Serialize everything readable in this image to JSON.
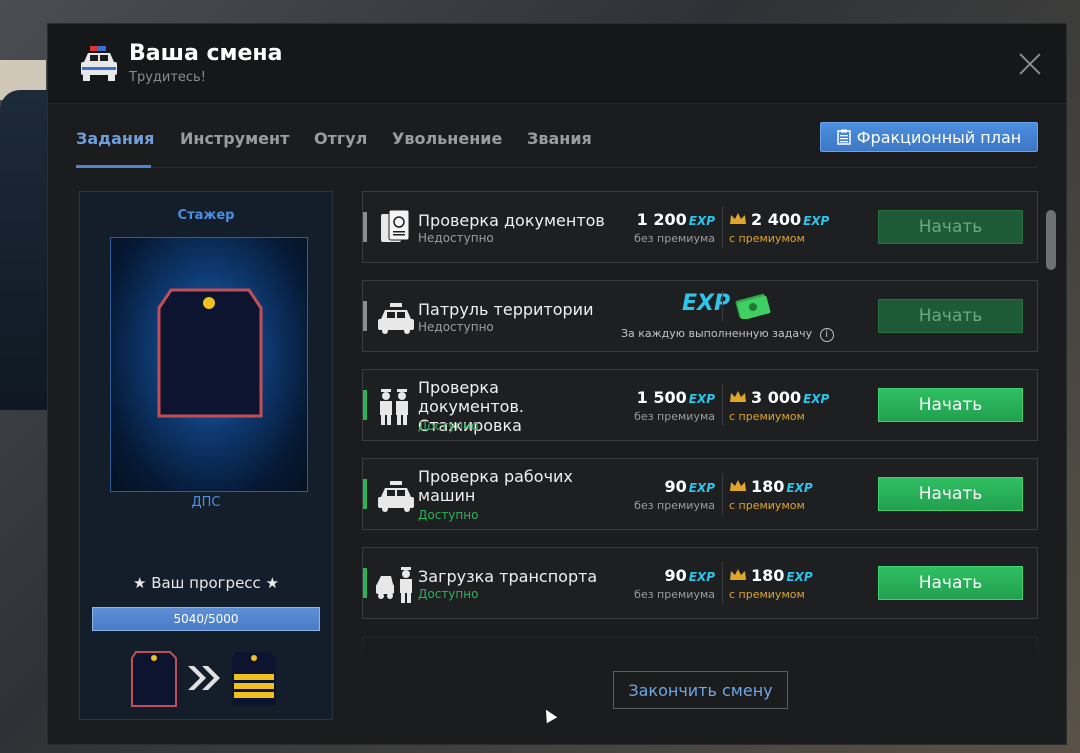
{
  "header": {
    "title": "Ваша смена",
    "subtitle": "Трудитесь!"
  },
  "tabs": [
    {
      "label": "Задания",
      "active": true
    },
    {
      "label": "Инструмент",
      "active": false
    },
    {
      "label": "Отгул",
      "active": false
    },
    {
      "label": "Увольнение",
      "active": false
    },
    {
      "label": "Звания",
      "active": false
    }
  ],
  "plan_button": {
    "label": "Фракционный план",
    "icon": "clipboard-icon"
  },
  "rank": {
    "name": "Стажер",
    "unit": "ДПС",
    "progress_label": "Ваш прогресс",
    "progress_text": "5040/5000",
    "progress_fraction": 1.0
  },
  "tasks": [
    {
      "name": "Проверка документов",
      "status": "Недоступно",
      "available": false,
      "reward": "1 200",
      "reward_premium": "2 400",
      "button": "Начать",
      "icon": "passport-icon"
    },
    {
      "name": "Патруль территории",
      "status": "Недоступно",
      "available": false,
      "special": true,
      "per_task_text": "За каждую выполненную задачу",
      "button": "Начать",
      "icon": "police-car-icon"
    },
    {
      "name": "Проверка документов. Стажировка",
      "status": "Доступно",
      "available": true,
      "reward": "1 500",
      "reward_premium": "3 000",
      "button": "Начать",
      "icon": "officers-icon"
    },
    {
      "name": "Проверка рабочих машин",
      "status": "Доступно",
      "available": true,
      "reward": "90",
      "reward_premium": "180",
      "button": "Начать",
      "icon": "police-car-icon"
    },
    {
      "name": "Загрузка транспорта",
      "status": "Доступно",
      "available": true,
      "reward": "90",
      "reward_premium": "180",
      "button": "Начать",
      "icon": "tow-truck-icon"
    }
  ],
  "labels": {
    "exp": "EXP",
    "no_premium": "без премиума",
    "with_premium": "с премиумом"
  },
  "end_button": "Закончить смену",
  "colors": {
    "accent": "#4b86d4",
    "available": "#2ab35a",
    "premium": "#e0a52b",
    "exp": "#2fc4ea"
  }
}
